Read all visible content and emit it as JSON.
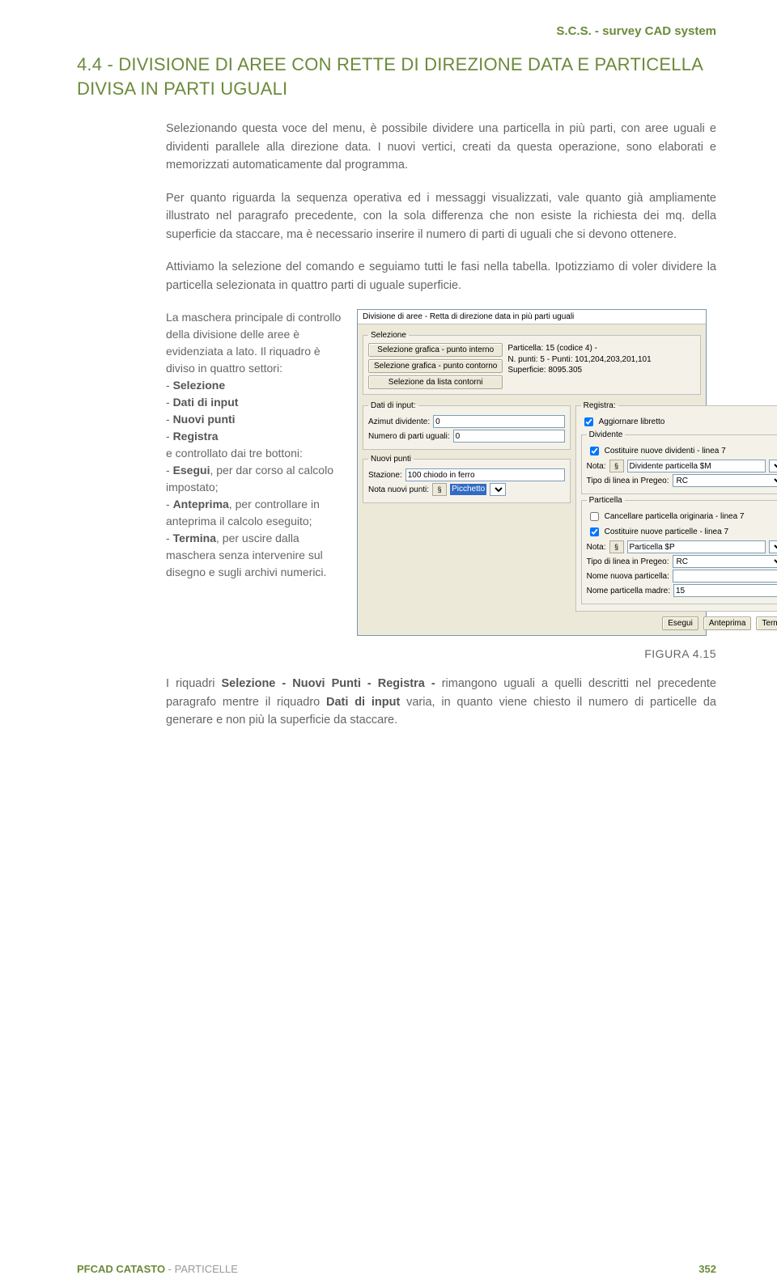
{
  "header": {
    "brand": "S.C.S. - survey CAD system"
  },
  "title": "4.4 - DIVISIONE DI AREE CON RETTE DI DIREZIONE DATA E PARTICELLA DIVISA IN PARTI UGUALI",
  "p1": "Selezionando questa voce del menu, è possibile dividere una particella in più parti, con aree uguali e dividenti parallele alla direzione data. I nuovi vertici, creati da questa operazione, sono elaborati e memorizzati automaticamente dal programma.",
  "p2": "Per quanto riguarda la sequenza operativa ed i messaggi visualizzati, vale quanto già ampliamente illustrato nel paragrafo precedente, con la sola differenza che non esiste la richiesta dei mq. della superficie da staccare, ma è necessario inserire il numero di parti di uguali che si devono ottenere.",
  "p3": "Attiviamo la selezione del comando e seguiamo tutti le fasi nella tabella. Ipotizziamo di voler dividere la particella selezionata in quattro parti di uguale superficie.",
  "leftdesc": {
    "intro": "La maschera principale di controllo della divisione delle aree è evidenziata a lato. Il riquadro è diviso in quattro settori:",
    "b1": "Selezione",
    "b2": "Dati di input",
    "b3": "Nuovi punti",
    "b4": "Registra",
    "mid": "e controllato dai tre bottoni:",
    "e1l": "Esegui",
    "e1t": ", per dar corso al calcolo impostato;",
    "e2l": "Anteprima",
    "e2t": ", per controllare in anteprima il calcolo eseguito;",
    "e3l": "Termina",
    "e3t": ", per uscire dalla maschera senza intervenire sul disegno e sugli archivi numerici."
  },
  "dialog": {
    "title": "Divisione di aree - Retta di direzione data in più parti uguali",
    "selezione": {
      "legend": "Selezione",
      "btn1": "Selezione grafica - punto interno",
      "btn2": "Selezione grafica - punto contorno",
      "btn3": "Selezione da lista contorni",
      "info1": "Particella: 15 (codice 4) -",
      "info2": "N. punti: 5 - Punti: 101,204,203,201,101",
      "info3": "Superficie: 8095.305"
    },
    "dati": {
      "legend": "Dati di input:",
      "azimut_l": "Azimut dividente:",
      "azimut_v": "0",
      "nparti_l": "Numero di parti uguali:",
      "nparti_v": "0"
    },
    "registra": {
      "legend": "Registra:",
      "chk1": "Aggiornare libretto",
      "grp_div": "Dividente",
      "chk2": "Costituire nuove dividenti - linea 7",
      "nota_l": "Nota:",
      "nota_v": "Dividente particella $M",
      "tipo_l": "Tipo di linea in Pregeo:",
      "tipo_v": "RC",
      "grp_part": "Particella",
      "chk3": "Cancellare particella originaria - linea 7",
      "chk4": "Costituire nuove particelle - linea 7",
      "nota2_v": "Particella $P",
      "tipo2_v": "RC",
      "nome_l": "Nome nuova particella:",
      "nome_v": "",
      "madre_l": "Nome particella madre:",
      "madre_v": "15"
    },
    "nuovi": {
      "legend": "Nuovi punti",
      "staz_l": "Stazione:",
      "staz_v": "100 chiodo in ferro",
      "nota_l": "Nota nuovi punti:",
      "nota_v": "Picchetto"
    },
    "buttons": {
      "b1": "Esegui",
      "b2": "Anteprima",
      "b3": "Termina"
    }
  },
  "figcap": "FIGURA 4.15",
  "p4a": "I riquadri ",
  "p4b": "Selezione - Nuovi Punti - Registra - ",
  "p4c": "rimangono uguali a quelli descritti nel precedente paragrafo mentre il riquadro ",
  "p4d": "Dati di input",
  "p4e": " varia, in quanto viene chiesto il numero di particelle da generare e non più la superficie da staccare.",
  "footer": {
    "l1": "PFCAD CATASTO",
    "l2": " - PARTICELLE",
    "page": "352"
  }
}
